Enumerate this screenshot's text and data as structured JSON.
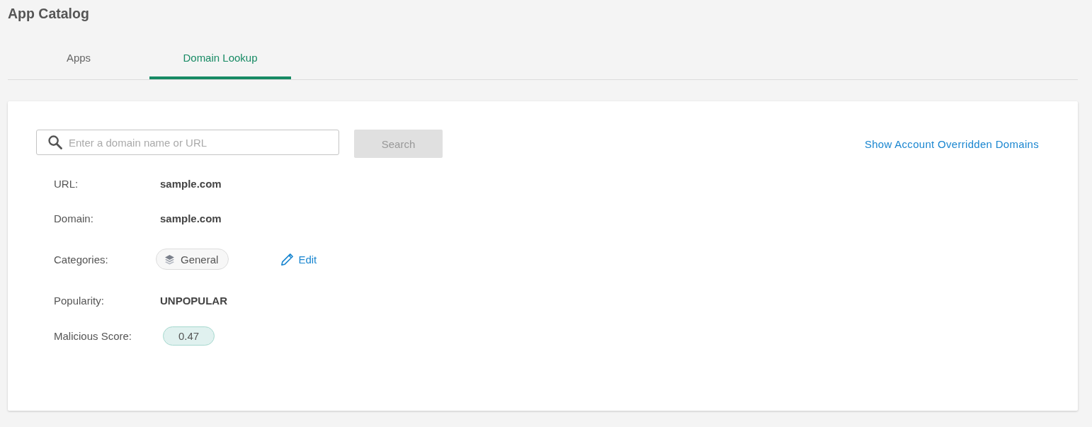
{
  "page": {
    "title": "App Catalog"
  },
  "tabs": [
    {
      "label": "Apps",
      "selected": false
    },
    {
      "label": "Domain Lookup",
      "selected": true
    }
  ],
  "lookup": {
    "search_field": {
      "placeholder": "Enter a domain name or URL"
    },
    "search_button": {
      "label": "Search",
      "disabled": true
    },
    "overrides_link": "Show Account Overridden Domains"
  },
  "details": [
    {
      "label": "URL:",
      "kind": "text",
      "value": "sample.com"
    },
    {
      "label": "Domain:",
      "kind": "text",
      "value": "sample.com"
    },
    {
      "label": "Categories:",
      "kind": "chips",
      "chips": [
        "General"
      ],
      "action": "Edit"
    },
    {
      "label": "Popularity:",
      "kind": "text",
      "value": "UNPOPULAR"
    },
    {
      "label": "Malicious Score:",
      "kind": "score",
      "value": "0.47"
    }
  ]
}
